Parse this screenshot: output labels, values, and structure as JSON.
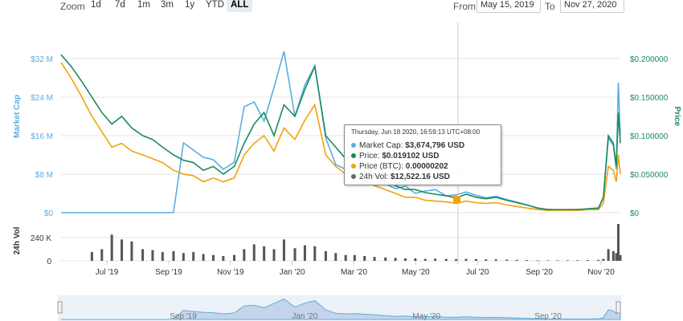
{
  "toolbar": {
    "zoom_label": "Zoom",
    "buttons": [
      "1d",
      "7d",
      "1m",
      "3m",
      "1y",
      "YTD",
      "ALL"
    ],
    "active": "ALL",
    "from_label": "From",
    "from_date": "May 15, 2019",
    "to_label": "To",
    "to_date": "Nov 27, 2020"
  },
  "colors": {
    "market_cap": "#5aaee0",
    "price": "#1b8a5a",
    "price_btc": "#f0a30a",
    "volume": "#555555",
    "left_axis": "#5aaee0",
    "right_axis": "#1b8a5a",
    "navigator_fill": "#c5d4ea"
  },
  "tooltip": {
    "header": "Thursday, Jun 18 2020, 16:59:13 UTC+08:00",
    "rows": [
      {
        "label": "Market Cap:",
        "value": "$3,674,796 USD",
        "color": "#5aaee0"
      },
      {
        "label": "Price:",
        "value": "$0.019102 USD",
        "color": "#1b8a5a"
      },
      {
        "label": "Price (BTC):",
        "value": "0.00000202",
        "color": "#f0a30a"
      },
      {
        "label": "24h Vol:",
        "value": "$12,522.16 USD",
        "color": "#666666"
      }
    ]
  },
  "chart_data": {
    "type": "line",
    "x_labels": [
      "Jul '19",
      "Sep '19",
      "Nov '19",
      "Jan '20",
      "Mar '20",
      "May '20",
      "Jul '20",
      "Sep '20",
      "Nov '20"
    ],
    "navigator_labels": [
      "Sep '19",
      "Jan '20",
      "May '20",
      "Sep '20"
    ],
    "left_axis": {
      "title": "Market Cap",
      "ticks": [
        "$0",
        "$8 M",
        "$16 M",
        "$24 M",
        "$32 M"
      ],
      "range": [
        0,
        32000000
      ]
    },
    "right_axis": {
      "title": "Price",
      "ticks": [
        "$0",
        "$0.050000",
        "$0.100000",
        "$0.150000",
        "$0.200000"
      ],
      "range": [
        0,
        0.2
      ]
    },
    "volume_axis": {
      "title": "24h Vol",
      "ticks": [
        "0",
        "240 K"
      ],
      "range": [
        0,
        240000
      ]
    },
    "x": [
      "2019-05-15",
      "2019-05-25",
      "2019-06-05",
      "2019-06-15",
      "2019-06-25",
      "2019-07-05",
      "2019-07-15",
      "2019-07-25",
      "2019-08-05",
      "2019-08-15",
      "2019-08-25",
      "2019-09-05",
      "2019-09-15",
      "2019-09-25",
      "2019-10-05",
      "2019-10-15",
      "2019-10-25",
      "2019-11-05",
      "2019-11-15",
      "2019-11-25",
      "2019-12-05",
      "2019-12-15",
      "2019-12-25",
      "2020-01-05",
      "2020-01-15",
      "2020-01-25",
      "2020-02-05",
      "2020-02-15",
      "2020-02-25",
      "2020-03-05",
      "2020-03-15",
      "2020-03-25",
      "2020-04-05",
      "2020-04-15",
      "2020-04-25",
      "2020-05-05",
      "2020-05-15",
      "2020-05-25",
      "2020-06-05",
      "2020-06-15",
      "2020-06-25",
      "2020-07-05",
      "2020-07-15",
      "2020-07-25",
      "2020-08-05",
      "2020-08-15",
      "2020-08-25",
      "2020-09-05",
      "2020-09-15",
      "2020-09-25",
      "2020-10-05",
      "2020-10-15",
      "2020-10-25",
      "2020-11-05",
      "2020-11-10",
      "2020-11-15",
      "2020-11-20",
      "2020-11-23",
      "2020-11-25",
      "2020-11-27"
    ],
    "series": [
      {
        "name": "Market Cap",
        "axis": "left",
        "values": [
          0,
          0,
          0,
          0,
          0,
          0,
          0,
          0,
          0,
          0,
          0,
          0,
          14500000,
          13000000,
          11500000,
          11000000,
          9000000,
          10500000,
          22000000,
          23000000,
          19000000,
          26000000,
          33500000,
          20000000,
          26500000,
          30500000,
          15500000,
          10000000,
          9000000,
          9500000,
          8500000,
          7500000,
          6000000,
          5000000,
          5500000,
          4000000,
          4500000,
          4800000,
          3500000,
          3700000,
          4300000,
          3600000,
          3100000,
          3400000,
          2700000,
          2200000,
          1600000,
          900000,
          700000,
          600000,
          600000,
          650000,
          700000,
          900000,
          3000000,
          15500000,
          14000000,
          9000000,
          27000000,
          16000000
        ]
      },
      {
        "name": "Price",
        "axis": "right",
        "values": [
          0.205,
          0.19,
          0.17,
          0.15,
          0.13,
          0.115,
          0.125,
          0.11,
          0.1,
          0.095,
          0.085,
          0.075,
          0.068,
          0.065,
          0.055,
          0.06,
          0.05,
          0.06,
          0.09,
          0.115,
          0.13,
          0.1,
          0.14,
          0.125,
          0.16,
          0.19,
          0.1,
          0.085,
          0.07,
          0.075,
          0.06,
          0.05,
          0.04,
          0.035,
          0.03,
          0.03,
          0.026,
          0.024,
          0.022,
          0.019,
          0.024,
          0.02,
          0.018,
          0.02,
          0.016,
          0.013,
          0.01,
          0.006,
          0.004,
          0.004,
          0.004,
          0.004,
          0.005,
          0.006,
          0.02,
          0.1,
          0.09,
          0.06,
          0.13,
          0.09
        ]
      },
      {
        "name": "Price (BTC)",
        "axis": "right",
        "values": [
          0.195,
          0.175,
          0.15,
          0.125,
          0.105,
          0.085,
          0.09,
          0.08,
          0.075,
          0.07,
          0.065,
          0.055,
          0.05,
          0.048,
          0.04,
          0.045,
          0.04,
          0.045,
          0.075,
          0.09,
          0.1,
          0.08,
          0.11,
          0.095,
          0.12,
          0.14,
          0.075,
          0.06,
          0.05,
          0.05,
          0.042,
          0.035,
          0.03,
          0.025,
          0.02,
          0.02,
          0.016,
          0.015,
          0.014,
          0.012,
          0.015,
          0.013,
          0.012,
          0.013,
          0.01,
          0.008,
          0.006,
          0.004,
          0.003,
          0.003,
          0.003,
          0.003,
          0.004,
          0.004,
          0.012,
          0.06,
          0.055,
          0.04,
          0.075,
          0.05
        ]
      },
      {
        "name": "24h Vol",
        "axis": "volume",
        "values": [
          0,
          0,
          0,
          90000,
          120000,
          270000,
          220000,
          200000,
          120000,
          110000,
          90000,
          100000,
          80000,
          90000,
          70000,
          60000,
          50000,
          60000,
          120000,
          170000,
          150000,
          120000,
          220000,
          130000,
          160000,
          150000,
          100000,
          80000,
          60000,
          60000,
          50000,
          40000,
          35000,
          30000,
          25000,
          25000,
          20000,
          22000,
          20000,
          18000,
          20000,
          18000,
          15000,
          15000,
          12000,
          10000,
          8000,
          5000,
          5000,
          5000,
          6000,
          7000,
          8000,
          10000,
          20000,
          120000,
          100000,
          80000,
          380000,
          60000
        ]
      }
    ]
  }
}
